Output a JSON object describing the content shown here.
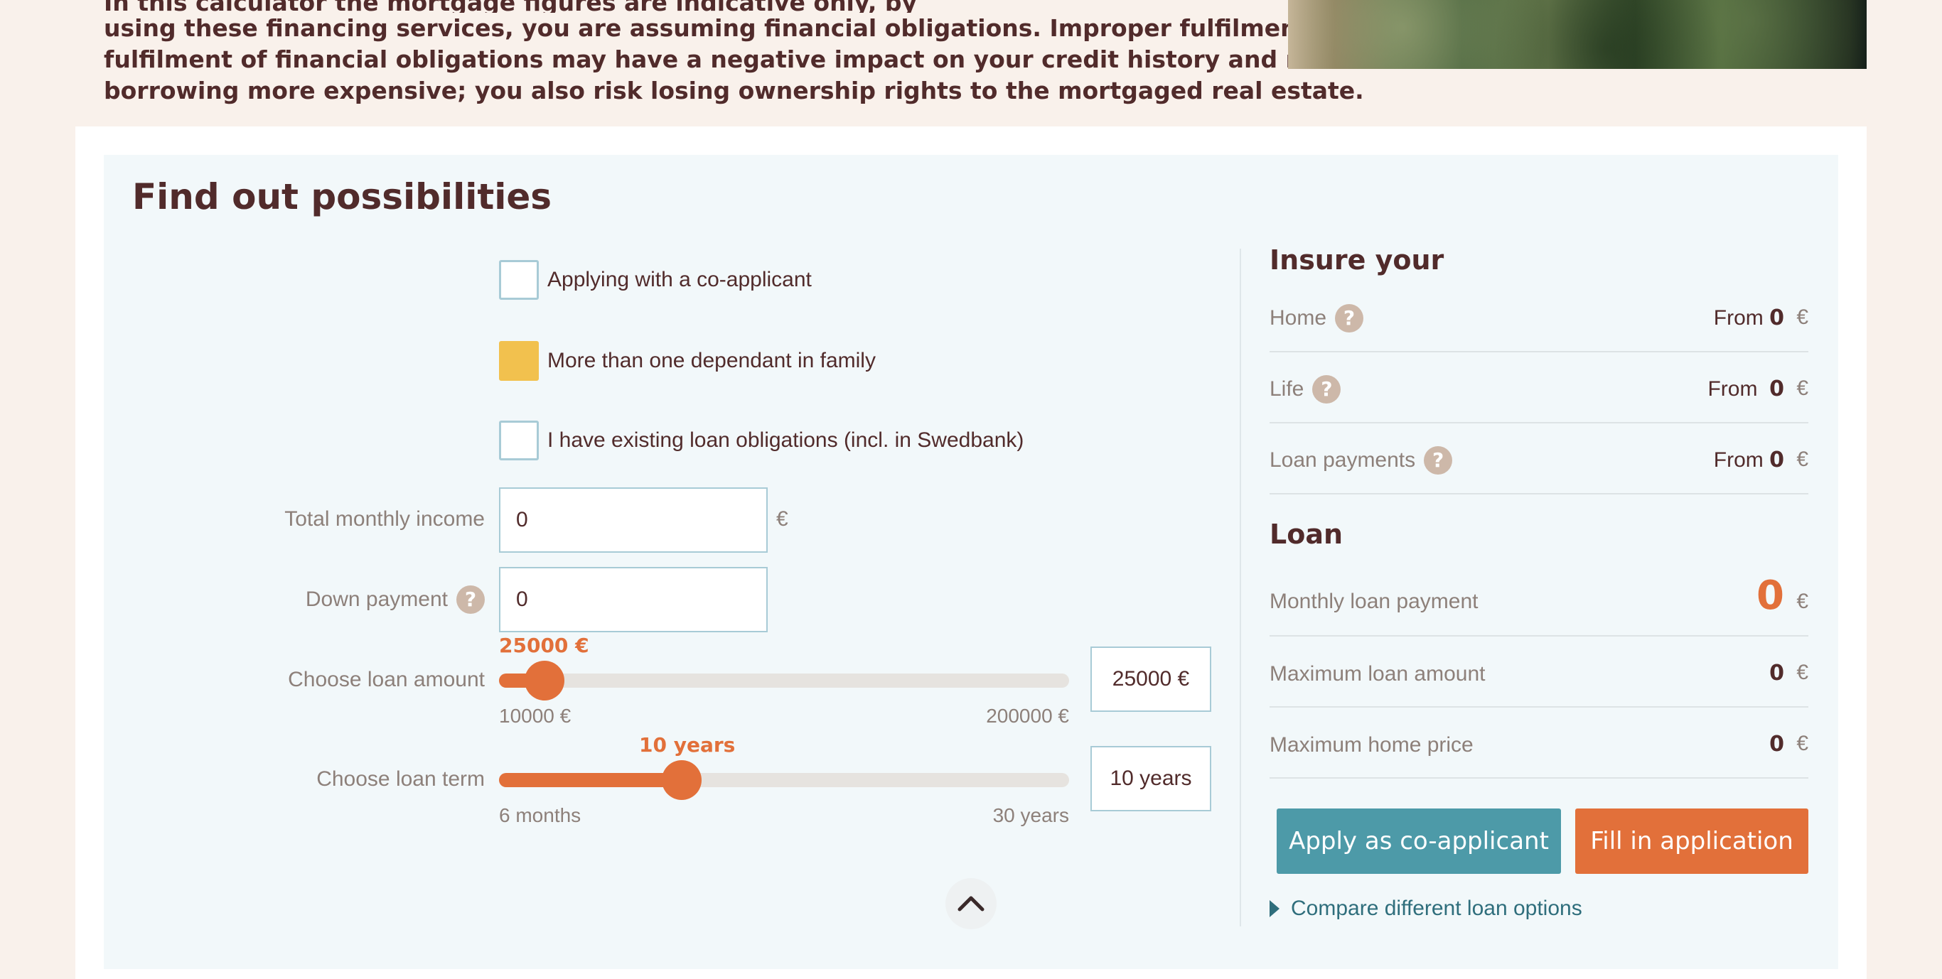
{
  "disclaimer": {
    "line0": "In this calculator the mortgage figures are indicative only, by",
    "line1": "using these financing services, you are assuming financial obligations. Improper fulfilment or non-",
    "line2": "fulfilment of financial obligations may have a negative impact on your credit history and make",
    "line3": "borrowing more expensive; you also risk losing ownership rights to the mortgaged real estate."
  },
  "calculator": {
    "title": "Find out possibilities",
    "checkboxes": [
      {
        "label": "Applying with a co-applicant",
        "checked": false
      },
      {
        "label": "More than one dependant in family",
        "checked": true
      },
      {
        "label": "I have existing loan obligations (incl. in Swedbank)",
        "checked": false
      }
    ],
    "income": {
      "label": "Total monthly income",
      "value": "0",
      "currency": "€"
    },
    "down_payment": {
      "label": "Down payment",
      "value": "0",
      "help": "?"
    },
    "loan_amount": {
      "label": "Choose loan amount",
      "value_label": "25000 €",
      "min_label": "10000 €",
      "max_label": "200000 €",
      "box_value": "25000 €",
      "level": 0.08
    },
    "loan_term": {
      "label": "Choose loan term",
      "value_label": "10 years",
      "min_label": "6 months",
      "max_label": "30 years",
      "box_value": "10 years",
      "level": 0.32
    }
  },
  "insure": {
    "heading": "Insure your",
    "rows": [
      {
        "label": "Home",
        "prefix": "From",
        "value": "0",
        "currency": "€"
      },
      {
        "label": "Life",
        "prefix": "From",
        "value": "0",
        "currency": "€"
      },
      {
        "label": "Loan payments",
        "prefix": "From",
        "value": "0",
        "currency": "€"
      }
    ]
  },
  "loan": {
    "heading": "Loan",
    "monthly": {
      "label": "Monthly loan payment",
      "value": "0",
      "currency": "€"
    },
    "max_amount": {
      "label": "Maximum loan amount",
      "value": "0",
      "currency": "€"
    },
    "max_price": {
      "label": "Maximum home price",
      "value": "0",
      "currency": "€"
    }
  },
  "actions": {
    "apply_co": "Apply as co-applicant",
    "fill_in": "Fill in application",
    "compare": "Compare different loan options"
  },
  "colors": {
    "accent": "#e2703a",
    "teal": "#4d9aa8",
    "brand_text": "#512b2b",
    "checked": "#f2c14e"
  }
}
